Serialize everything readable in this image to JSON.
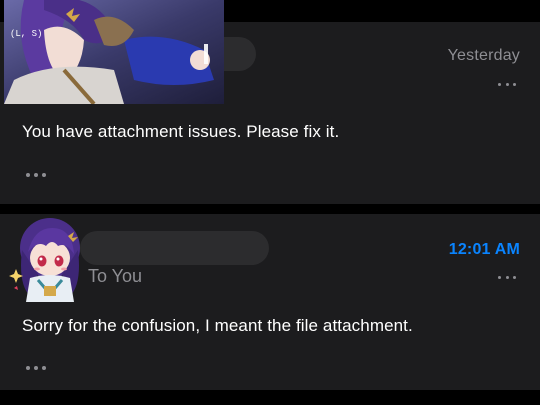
{
  "messages": [
    {
      "timestamp": "Yesterday",
      "body": "You have attachment issues. Please fix it."
    },
    {
      "timestamp": "12:01 AM",
      "recipient": "To You",
      "body": "Sorry for the confusion, I meant the file attachment."
    }
  ],
  "banner": {
    "caption": "(L, S)"
  },
  "colors": {
    "background": "#000000",
    "card": "#1c1c1e",
    "secondary_text": "#8e8e93",
    "accent_time": "#0a84ff",
    "primary_text": "#ffffff"
  },
  "icons": {
    "more": "ellipsis-icon",
    "expand": "ellipsis-icon"
  }
}
